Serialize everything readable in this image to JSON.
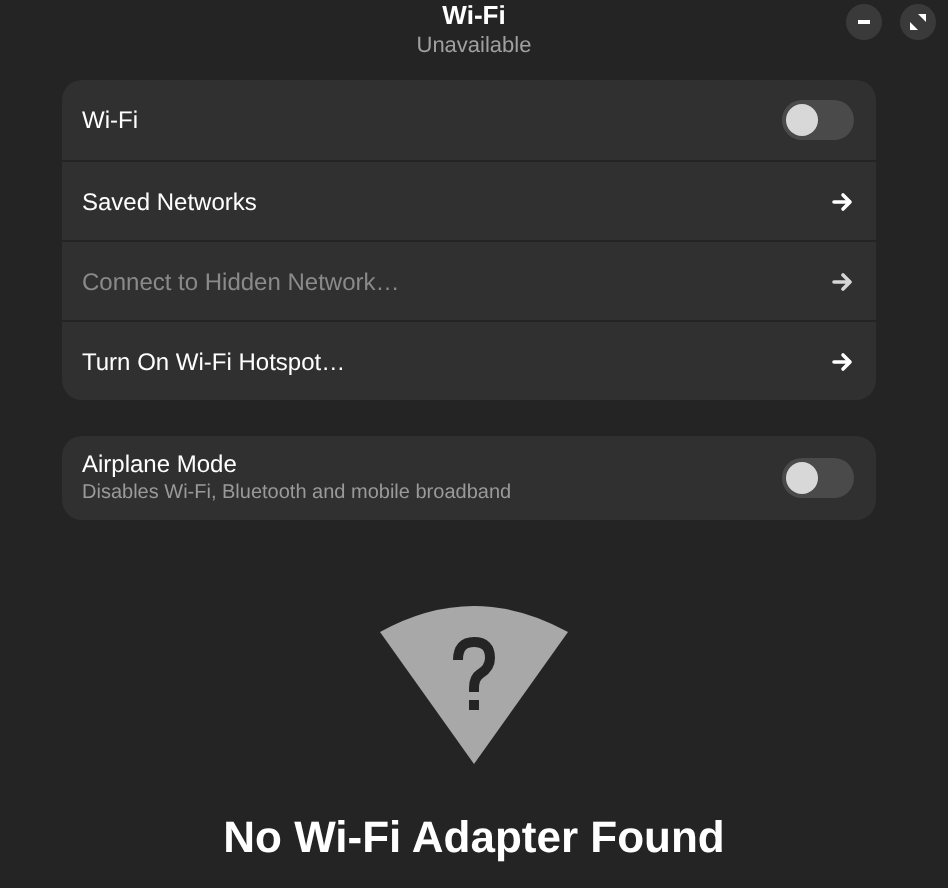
{
  "header": {
    "title": "Wi-Fi",
    "subtitle": "Unavailable"
  },
  "wifi_card": {
    "rows": [
      {
        "kind": "toggle",
        "label": "Wi-Fi",
        "on": false,
        "disabled": false
      },
      {
        "kind": "link",
        "label": "Saved Networks",
        "disabled": false
      },
      {
        "kind": "link",
        "label": "Connect to Hidden Network…",
        "disabled": true
      },
      {
        "kind": "link",
        "label": "Turn On Wi-Fi Hotspot…",
        "disabled": false
      }
    ]
  },
  "airplane_mode": {
    "label": "Airplane Mode",
    "description": "Disables Wi-Fi, Bluetooth and mobile broadband",
    "on": false
  },
  "status": {
    "heading": "No Wi-Fi Adapter Found"
  }
}
